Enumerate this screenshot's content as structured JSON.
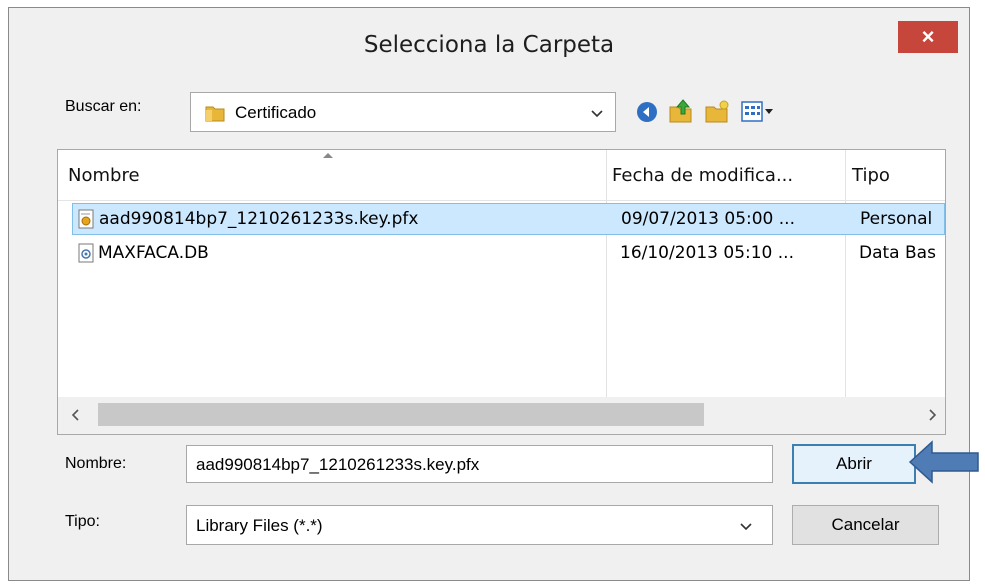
{
  "dialog": {
    "title": "Selecciona la Carpeta",
    "close_label": "×"
  },
  "lookin": {
    "label": "Buscar en:",
    "value": "Certificado"
  },
  "columns": [
    "Nombre",
    "Fecha de modifica...",
    "Tipo"
  ],
  "files": [
    {
      "name": "aad990814bp7_1210261233s.key.pfx",
      "date": "09/07/2013 05:00 ...",
      "type": "Personal",
      "icon": "certificate-file-icon",
      "selected": true
    },
    {
      "name": "MAXFACA.DB",
      "date": "16/10/2013 05:10 ...",
      "type": "Data Bas",
      "icon": "database-file-icon",
      "selected": false
    }
  ],
  "filename": {
    "label": "Nombre:",
    "value": "aad990814bp7_1210261233s.key.pfx"
  },
  "filetype": {
    "label": "Tipo:",
    "value": "Library Files (*.*)"
  },
  "buttons": {
    "open": "Abrir",
    "cancel": "Cancelar"
  },
  "colors": {
    "close": "#c7463c",
    "selection": "#cce8ff",
    "arrow": "#4f7cb4"
  }
}
